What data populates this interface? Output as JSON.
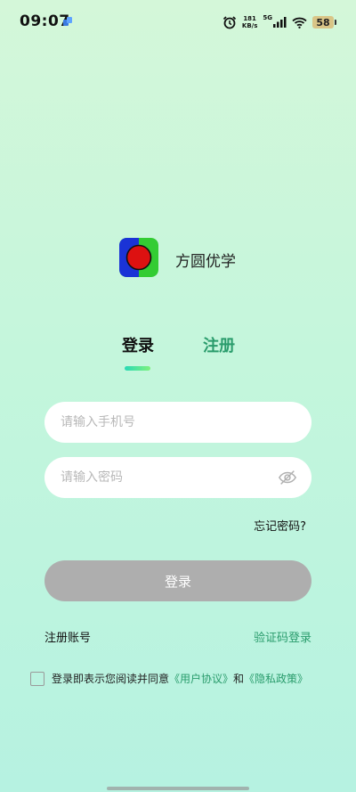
{
  "status_bar": {
    "time": "09:07",
    "net_speed_value": "181",
    "net_speed_unit": "KB/s",
    "network_type": "5G",
    "battery_level": "58",
    "icons": [
      "alarm-icon",
      "signal-icon",
      "wifi-icon",
      "battery-icon"
    ]
  },
  "app": {
    "name": "方圆优学"
  },
  "tabs": {
    "login": "登录",
    "register": "注册",
    "active": "login"
  },
  "form": {
    "phone_placeholder": "请输入手机号",
    "phone_value": "",
    "password_placeholder": "请输入密码",
    "password_value": "",
    "forgot_password": "忘记密码?",
    "submit": "登录"
  },
  "links": {
    "register_account": "注册账号",
    "code_login": "验证码登录"
  },
  "agreement": {
    "checked": false,
    "prefix": "登录即表示您阅读并同意",
    "user_agreement": "《用户协议》",
    "and": "和",
    "privacy_policy": "《隐私政策》"
  },
  "colors": {
    "accent": "#2a9c6c",
    "button_disabled": "#aeaeae",
    "background_top": "#d4f7d9",
    "background_bottom": "#b6f2e1",
    "logo_blue": "#1a33d6",
    "logo_green": "#33cc33",
    "logo_red": "#dd1111"
  }
}
